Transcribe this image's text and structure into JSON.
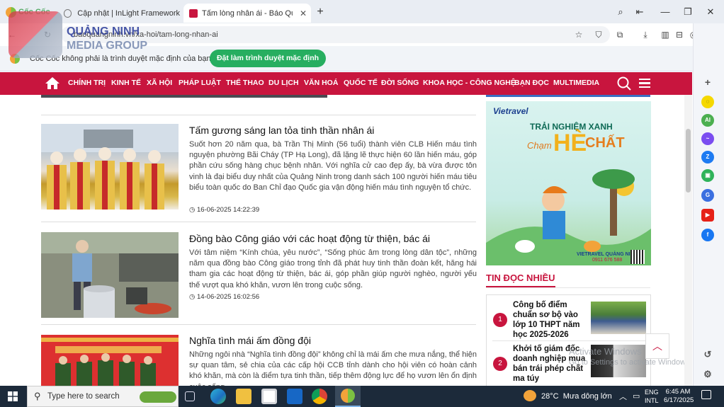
{
  "browser": {
    "tabs": [
      {
        "label": "Cập nhật | InLight Framework",
        "active": false
      },
      {
        "label": "Tấm lòng nhân ái - Báo Quả",
        "active": true
      }
    ],
    "brand": "Cốc Cốc",
    "url": "baoquangninh.vn/xa-hoi/tam-long-nhan-ai",
    "infobar": {
      "message": "Cốc Cốc không phải là trình duyệt mặc định của bạn",
      "button": "Đặt làm trình duyệt mặc định"
    }
  },
  "site": {
    "logo_line1": "QUẢNG NINH",
    "logo_line2": "MEDIA GROUP",
    "nav": [
      "CHÍNH TRỊ",
      "KINH TẾ",
      "XÃ HỘI",
      "PHÁP LUẬT",
      "THỂ THAO",
      "DU LỊCH",
      "VĂN HOÁ",
      "QUỐC TẾ",
      "ĐỜI SỐNG",
      "KHOA HỌC - CÔNG NGHỆ",
      "BẠN ĐỌC",
      "MULTIMEDIA"
    ]
  },
  "articles": [
    {
      "title": "Tấm gương sáng lan tỏa tinh thần nhân ái",
      "summary": "Suốt hơn 20 năm qua, bà Trần Thị Minh (56 tuổi) thành viên CLB Hiến máu tình nguyện phường Bãi Cháy (TP Hạ Long), đã lặng lẽ thực hiện 60 lần hiến máu, góp phần cứu sống hàng chục bệnh nhân. Với nghĩa cử cao đẹp ấy, bà vừa được tôn vinh là đại biểu duy nhất của Quảng Ninh trong danh sách 100 người hiến máu tiêu biểu toàn quốc do Ban Chỉ đạo Quốc gia vận động hiến máu tình nguyện tổ chức.",
      "time": "16-06-2025 14:22:39"
    },
    {
      "title": "Đồng bào Công giáo với các hoạt động từ thiện, bác ái",
      "summary": "Với tâm niệm “Kính chúa, yêu nước”, “Sống phúc âm trong lòng dân tộc”, những năm qua đồng bào Công giáo trong tỉnh đã phát huy tinh thần đoàn kết, hăng hái tham gia các hoạt động từ thiện, bác ái, góp phần giúp người nghèo, người yếu thế vượt qua khó khăn, vươn lên trong cuộc sống.",
      "time": "14-06-2025 16:02:56"
    },
    {
      "title": "Nghĩa tình mái ấm đồng đội",
      "summary": "Những ngôi nhà “Nghĩa tình đồng đội” không chỉ là mái ấm che mưa nắng, thể hiện sự quan tâm, sẻ chia của các cấp hội CCB tỉnh dành cho hội viên có hoàn cảnh khó khăn, mà còn là điểm tựa tinh thần, tiếp thêm động lực để họ vươn lên ổn định cuộc sống.",
      "time": ""
    }
  ],
  "ad": {
    "brand": "Vietravel",
    "line1": "TRẢI NGHIỆM XANH",
    "script": "Chạm",
    "big1": "HÈ",
    "big2": "CHẤT",
    "footer": "VIETRAVEL QUẢNG NINH",
    "phone": "0911 676 588"
  },
  "most_read": {
    "heading": "TIN ĐỌC NHIỀU",
    "items": [
      {
        "rank": "1",
        "title": "Công bố điểm chuẩn sơ bộ vào lớp 10 THPT năm học 2025-2026"
      },
      {
        "rank": "2",
        "title": "Khởi tố giám đốc doanh nghiệp mua bán trái phép chất ma túy"
      }
    ]
  },
  "watermark": {
    "line1": "Activate Windows",
    "line2": "Go to Settings to activate Windows."
  },
  "taskbar": {
    "search_placeholder": "Type here to search",
    "weather": "28°C  Mưa dông lớn",
    "lang1": "ENG",
    "lang2": "INTL",
    "time": "6:45 AM",
    "date": "6/17/2025"
  },
  "colors": {
    "brand_red": "#c8153e",
    "infobar_button": "#27ae60",
    "taskbar": "#1c2a3a"
  }
}
